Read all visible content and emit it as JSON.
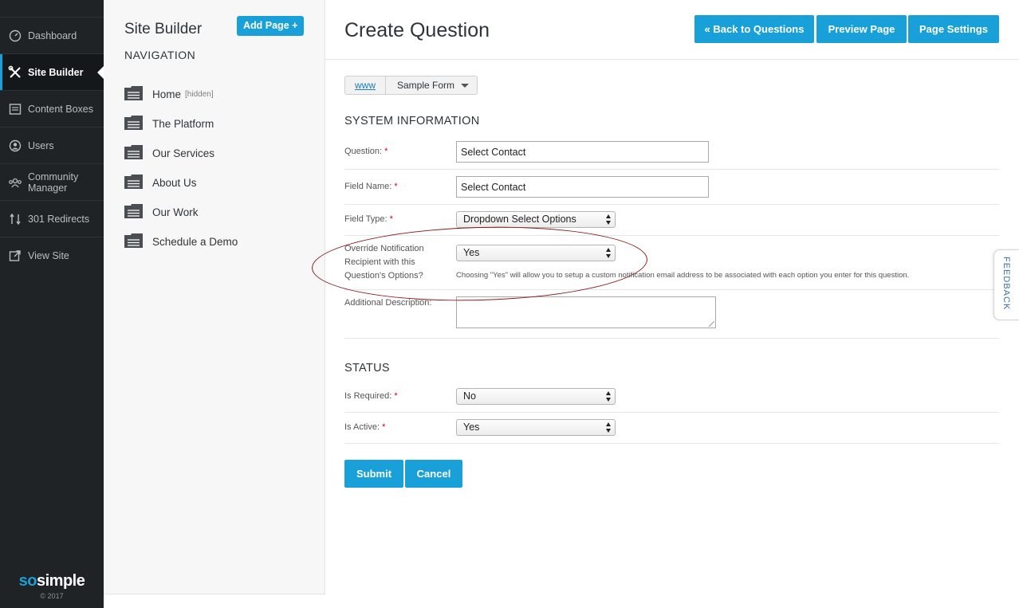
{
  "sidebar": {
    "items": [
      {
        "label": "Dashboard",
        "icon": "dashboard-icon"
      },
      {
        "label": "Site Builder",
        "icon": "tools-icon"
      },
      {
        "label": "Content Boxes",
        "icon": "content-box-icon"
      },
      {
        "label": "Users",
        "icon": "user-icon"
      },
      {
        "label": "Community Manager",
        "icon": "community-icon"
      },
      {
        "label": "301 Redirects",
        "icon": "redirect-icon"
      },
      {
        "label": "View Site",
        "icon": "external-link-icon"
      }
    ],
    "active_index": 1,
    "brand": {
      "so": "so",
      "simple": "simple",
      "copyright": "© 2017"
    }
  },
  "navpanel": {
    "title": "Site Builder",
    "add_page_label": "Add Page +",
    "subtitle": "NAVIGATION",
    "pages": [
      {
        "label": "Home",
        "tag": "[hidden]"
      },
      {
        "label": "The Platform",
        "tag": ""
      },
      {
        "label": "Our Services",
        "tag": ""
      },
      {
        "label": "About Us",
        "tag": ""
      },
      {
        "label": "Our Work",
        "tag": ""
      },
      {
        "label": "Schedule a Demo",
        "tag": ""
      }
    ]
  },
  "header": {
    "title": "Create Question",
    "buttons": {
      "back": "« Back to Questions",
      "preview": "Preview Page",
      "settings": "Page Settings"
    }
  },
  "breadcrumb": {
    "root": "www",
    "current": "Sample Form"
  },
  "system_info": {
    "heading": "SYSTEM INFORMATION",
    "question_label": "Question:",
    "question_value": "Select Contact",
    "field_name_label": "Field Name:",
    "field_name_value": "Select Contact",
    "field_type_label": "Field Type:",
    "field_type_value": "Dropdown Select Options",
    "override_label": "Override Notification Recipient with this Question's Options?",
    "override_value": "Yes",
    "override_hint": "Choosing \"Yes\" will allow you to setup a custom notification email address to be associated with each option you enter for this question.",
    "additional_label": "Additional Description:",
    "additional_value": ""
  },
  "status": {
    "heading": "STATUS",
    "required_label": "Is Required:",
    "required_value": "No",
    "active_label": "Is Active:",
    "active_value": "Yes"
  },
  "form_buttons": {
    "submit": "Submit",
    "cancel": "Cancel"
  },
  "required_marker": "*",
  "feedback_tab": "FEEDBACK",
  "colors": {
    "accent": "#1aa0d8",
    "sidebar_bg": "#1f2326",
    "required": "#d0021b",
    "annotation": "#8b1a1a"
  }
}
